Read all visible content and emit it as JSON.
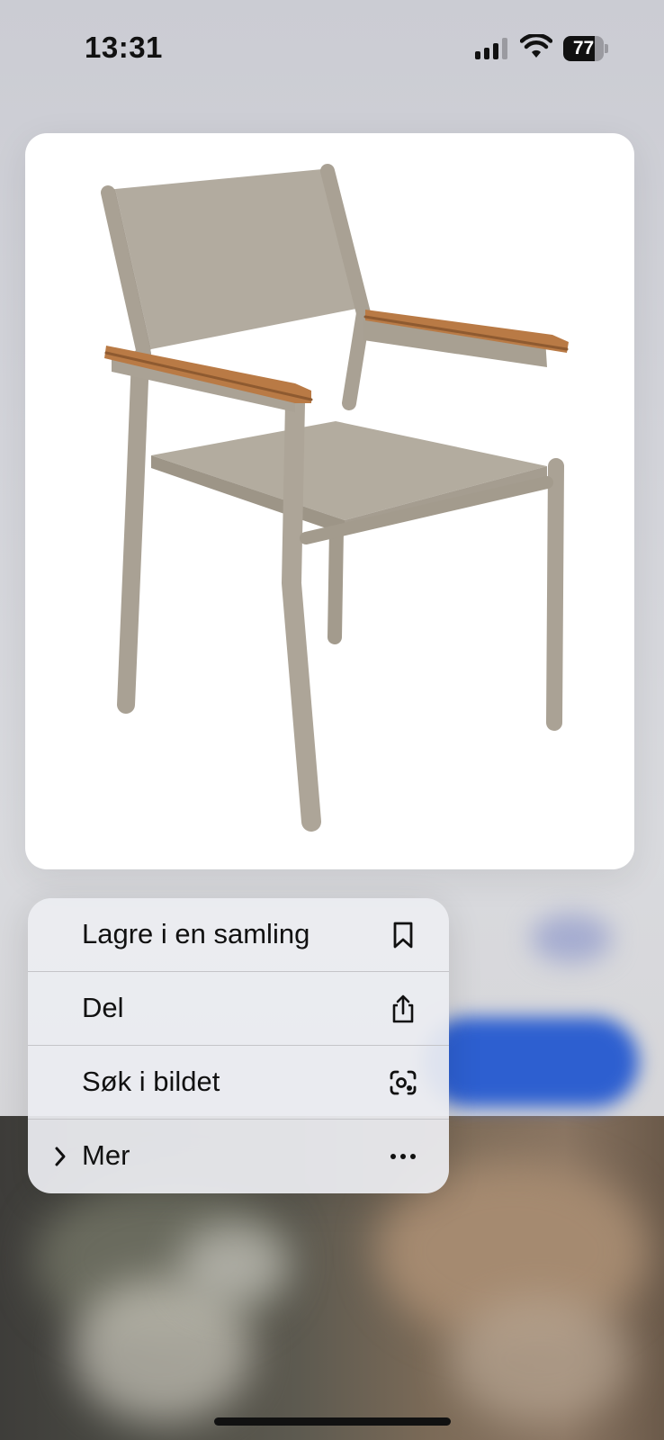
{
  "status_bar": {
    "time": "13:31",
    "battery_percent": "77",
    "battery_level": 0.77
  },
  "preview_image": {
    "subject_icon": "chair-image"
  },
  "menu": {
    "items": [
      {
        "label": "Lagre i en samling",
        "icon": "bookmark-icon"
      },
      {
        "label": "Del",
        "icon": "share-icon"
      },
      {
        "label": "Søk i bildet",
        "icon": "visual-search-icon"
      },
      {
        "label": "Mer",
        "icon": "more-icon",
        "leading_icon": "chevron-right-icon"
      }
    ]
  },
  "colors": {
    "accent_blue": "#2d5fd0",
    "chair_frame": "#a9a193",
    "chair_wood": "#b97a45"
  }
}
